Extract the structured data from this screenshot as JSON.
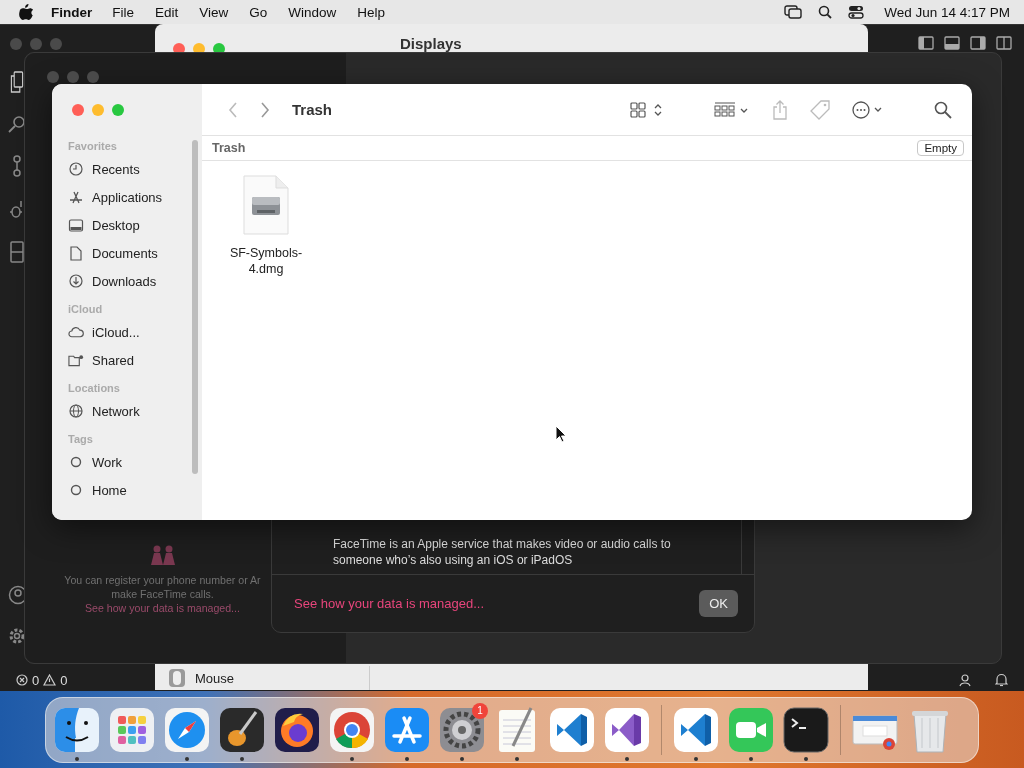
{
  "menu_bar": {
    "app": "Finder",
    "items": [
      "File",
      "Edit",
      "View",
      "Go",
      "Window",
      "Help"
    ],
    "clock": "Wed Jun 14  4:17 PM"
  },
  "code_editor": {
    "errors": "0",
    "warnings": "0"
  },
  "settings_window": {
    "title": "Displays",
    "row": "Mouse"
  },
  "facetime_window": {
    "panel_lines": [
      "You can register your phone number or Ar",
      "make FaceTime calls."
    ],
    "panel_link": "See how your data is managed...",
    "dialog": {
      "text": "FaceTime is an Apple service that makes video or audio calls to someone who’s also using an iOS or iPadOS",
      "link": "See how your data is managed...",
      "button": "OK"
    }
  },
  "finder": {
    "title": "Trash",
    "path": "Trash",
    "empty_button": "Empty",
    "sidebar": [
      {
        "heading": "Favorites",
        "items": [
          {
            "label": "Recents",
            "kind": "clock"
          },
          {
            "label": "Applications",
            "kind": "apps"
          },
          {
            "label": "Desktop",
            "kind": "desktop"
          },
          {
            "label": "Documents",
            "kind": "doc"
          },
          {
            "label": "Downloads",
            "kind": "download"
          }
        ]
      },
      {
        "heading": "iCloud",
        "items": [
          {
            "label": "iCloud...",
            "kind": "cloud"
          },
          {
            "label": "Shared",
            "kind": "shared"
          }
        ]
      },
      {
        "heading": "Locations",
        "items": [
          {
            "label": "Network",
            "kind": "network"
          }
        ]
      },
      {
        "heading": "Tags",
        "items": [
          {
            "label": "Work",
            "kind": "tag"
          },
          {
            "label": "Home",
            "kind": "tag"
          }
        ]
      }
    ],
    "files": [
      {
        "name": "SF-Symbols-4.dmg"
      }
    ]
  },
  "dock": [
    {
      "kind": "finder",
      "running": true
    },
    {
      "kind": "launchpad",
      "running": false
    },
    {
      "kind": "safari",
      "running": true
    },
    {
      "kind": "garageband",
      "running": true
    },
    {
      "kind": "firefox",
      "running": false
    },
    {
      "kind": "chrome",
      "running": true
    },
    {
      "kind": "appstore",
      "running": true
    },
    {
      "kind": "settings",
      "running": true,
      "badge": "1"
    },
    {
      "kind": "textedit",
      "running": true
    },
    {
      "kind": "vscode",
      "running": false
    },
    {
      "kind": "vstudio",
      "running": true
    },
    {
      "kind": "divider"
    },
    {
      "kind": "vscode",
      "running": true
    },
    {
      "kind": "facetime",
      "running": true
    },
    {
      "kind": "terminal",
      "running": true
    },
    {
      "kind": "divider"
    },
    {
      "kind": "preview",
      "running": false
    },
    {
      "kind": "trash",
      "running": false
    }
  ]
}
